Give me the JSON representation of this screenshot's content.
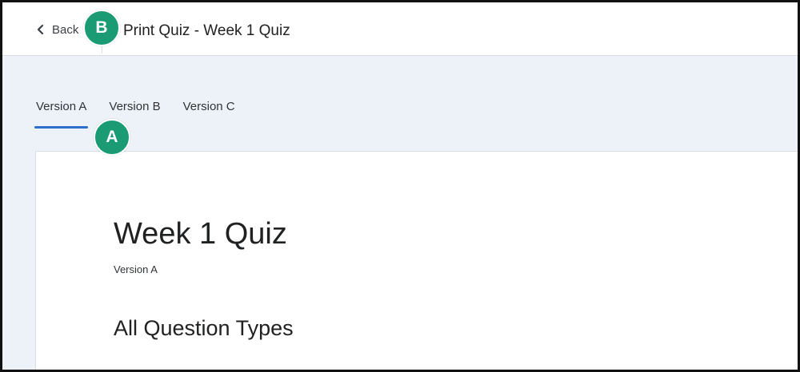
{
  "header": {
    "back_label": "Back",
    "title": "Print Quiz - Week 1 Quiz"
  },
  "callouts": {
    "a": "A",
    "b": "B"
  },
  "tabs": [
    {
      "label": "Version A",
      "active": true
    },
    {
      "label": "Version B",
      "active": false
    },
    {
      "label": "Version C",
      "active": false
    }
  ],
  "content": {
    "quiz_title": "Week 1 Quiz",
    "version_label": "Version A",
    "section_heading": "All Question Types"
  },
  "icons": {
    "back": "chevron-left-icon"
  },
  "colors": {
    "accent": "#2c6ec9",
    "callout": "#1a9b73",
    "page_background": "#edf2f8"
  }
}
